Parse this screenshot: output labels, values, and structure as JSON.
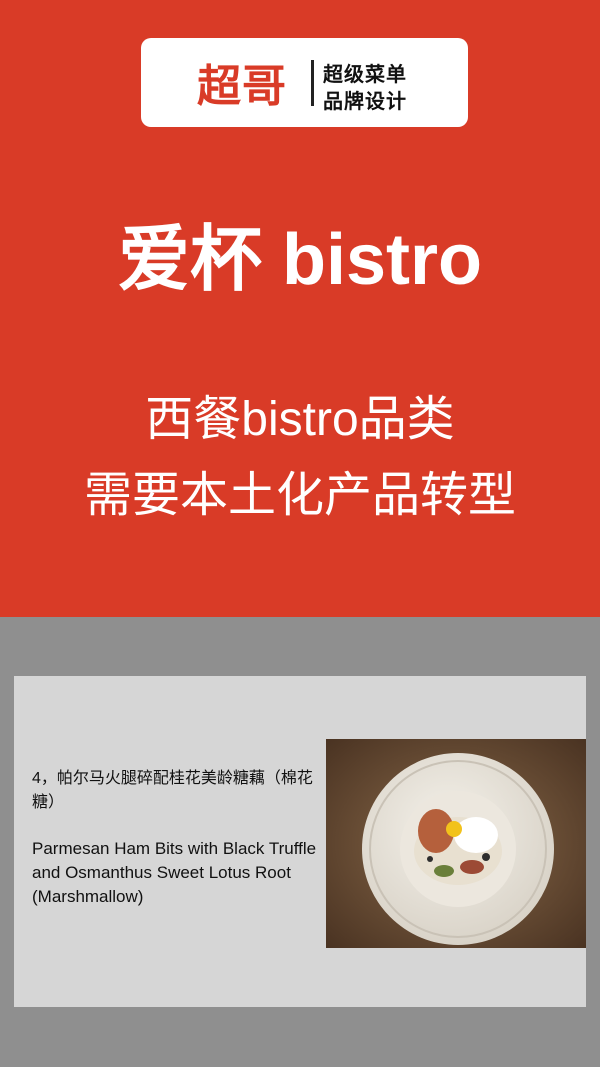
{
  "brand": {
    "logo": "超哥",
    "tagline_1": "超级菜单",
    "tagline_2": "品牌设计"
  },
  "hero": {
    "title": "爱杯 bistro",
    "subtitle_1": "西餐bistro品类",
    "subtitle_2": "需要本土化产品转型"
  },
  "slide": {
    "dish_zh": "4，帕尔马火腿碎配桂花美龄糖藕（棉花糖）",
    "dish_en": "Parmesan Ham Bits with Black Truffle and Osmanthus Sweet Lotus Root (Marshmallow)",
    "photo_icon": "plated-dish-photo"
  },
  "colors": {
    "brand_red": "#d93b27",
    "background_gray": "#8f8f8f",
    "slide_gray": "#d6d6d6"
  }
}
